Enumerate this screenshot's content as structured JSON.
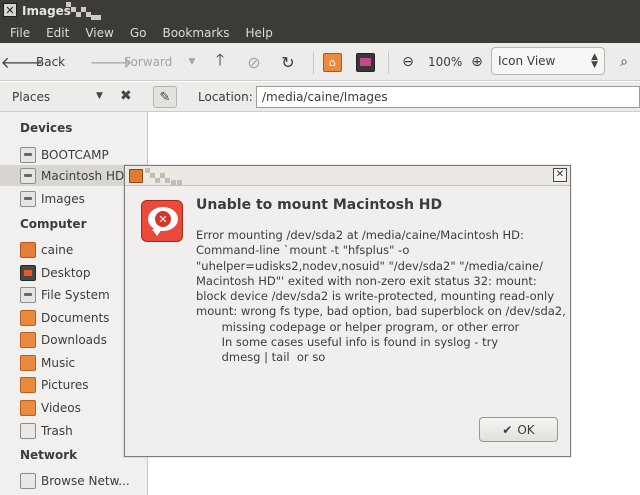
{
  "window": {
    "title": "Images"
  },
  "menu": [
    "File",
    "Edit",
    "View",
    "Go",
    "Bookmarks",
    "Help"
  ],
  "toolbar": {
    "back_label": "Back",
    "forward_label": "Forward",
    "zoom_level": "100%",
    "view_mode": "Icon View"
  },
  "location": {
    "places_label": "Places",
    "label": "Location:",
    "path": "/media/caine/Images"
  },
  "sidebar": {
    "sections": {
      "devices": "Devices",
      "computer": "Computer",
      "network": "Network"
    },
    "devices": [
      {
        "label": "BOOTCAMP",
        "icon": "drive-icon"
      },
      {
        "label": "Macintosh HD",
        "icon": "drive-icon"
      },
      {
        "label": "Images",
        "icon": "drive-icon"
      }
    ],
    "computer": [
      {
        "label": "caine",
        "icon": "home-folder-icon"
      },
      {
        "label": "Desktop",
        "icon": "desktop-icon"
      },
      {
        "label": "File System",
        "icon": "drive-icon"
      },
      {
        "label": "Documents",
        "icon": "folder-icon"
      },
      {
        "label": "Downloads",
        "icon": "folder-icon"
      },
      {
        "label": "Music",
        "icon": "folder-icon"
      },
      {
        "label": "Pictures",
        "icon": "folder-icon"
      },
      {
        "label": "Videos",
        "icon": "folder-icon"
      },
      {
        "label": "Trash",
        "icon": "trash-icon"
      }
    ],
    "network": [
      {
        "label": "Browse Netw...",
        "icon": "network-icon"
      }
    ]
  },
  "dialog": {
    "heading": "Unable to mount Macintosh HD",
    "message_lines": [
      "Error mounting /dev/sda2 at /media/caine/Macintosh HD:",
      "Command-line `mount -t \"hfsplus\" -o",
      "\"uhelper=udisks2,nodev,nosuid\" \"/dev/sda2\" \"/media/caine/",
      "Macintosh HD\"' exited with non-zero exit status 32: mount:",
      "block device /dev/sda2 is write-protected, mounting read-only",
      "mount: wrong fs type, bad option, bad superblock on /dev/sda2,",
      "       missing codepage or helper program, or other error",
      "       In some cases useful info is found in syslog - try",
      "       dmesg | tail  or so"
    ],
    "ok_label": "OK"
  },
  "colors": {
    "titlebar": "#3c3b37",
    "accent_orange": "#e07b32",
    "error_red": "#ea4a3c"
  }
}
